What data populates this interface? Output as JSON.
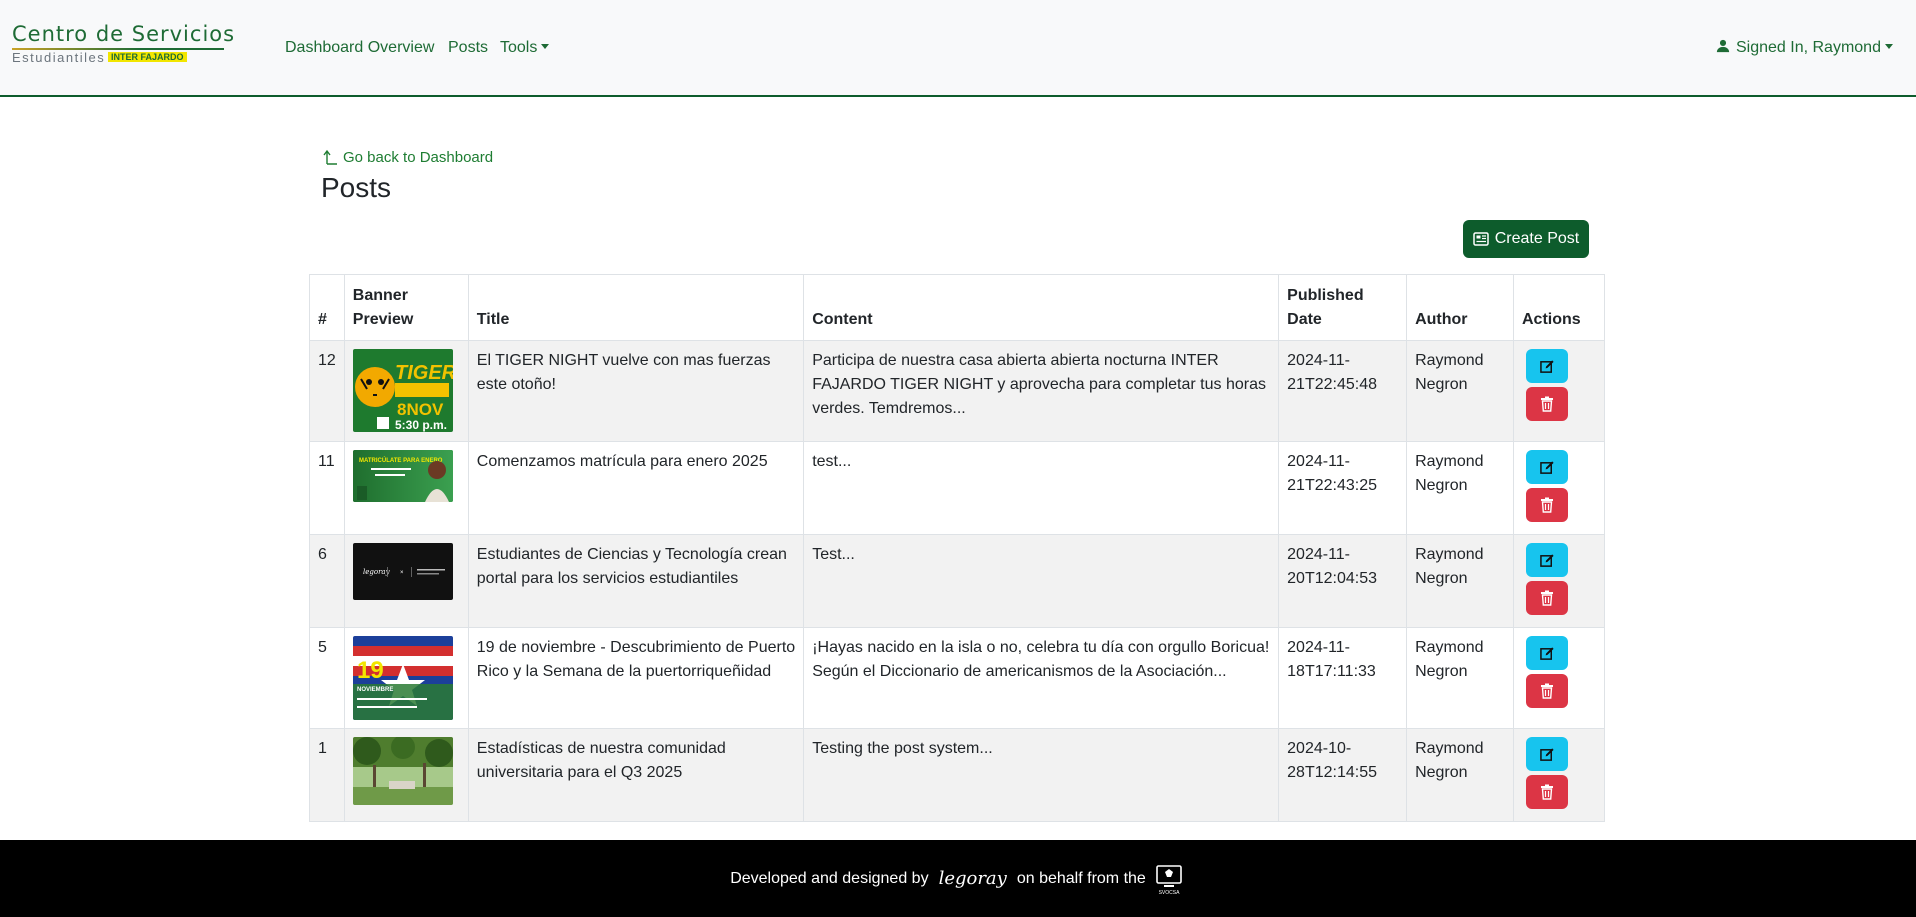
{
  "brand": {
    "line1": "Centro de Servicios",
    "line2": "Estudiantiles",
    "inter": "INTER",
    "inter_campus": "FAJARDO"
  },
  "nav": {
    "dashboard": "Dashboard Overview",
    "posts": "Posts",
    "tools": "Tools",
    "user": "Signed In, Raymond"
  },
  "main": {
    "back_link": "Go back to Dashboard",
    "title": "Posts",
    "create_button": "Create Post"
  },
  "table": {
    "headers": {
      "num": "#",
      "banner": "Banner Preview",
      "title": "Title",
      "content": "Content",
      "published": "Published Date",
      "author": "Author",
      "actions": "Actions"
    },
    "rows": [
      {
        "id": "12",
        "title": "El TIGER NIGHT vuelve con mas fuerzas este otoño!",
        "content": "Participa de nuestra casa abierta abierta nocturna INTER FAJARDO TIGER NIGHT y aprovecha para completar tus horas verdes. Temdremos...",
        "date_a": "2024-11-",
        "date_b": "21T22:45:48",
        "author_a": "Raymond",
        "author_b": "Negron",
        "thumb": {
          "bg": "#1e7a2e",
          "accent": "#f2c200",
          "text1": "TIGER",
          "text2": "8NOV",
          "text3": "5:30 p.m."
        }
      },
      {
        "id": "11",
        "title": "Comenzamos matrícula para enero 2025",
        "content": "test...",
        "date_a": "2024-11-",
        "date_b": "21T22:43:25",
        "author_a": "Raymond",
        "author_b": "Negron",
        "thumb": {
          "bg": "#2e8b3e",
          "accent": "#f2e600",
          "text1": "MATRICÚLATE PARA ENERO"
        }
      },
      {
        "id": "6",
        "title": "Estudiantes de Ciencias y Tecnología crean portal para los servicios estudiantiles",
        "content": "Test...",
        "date_a": "2024-11-",
        "date_b": "20T12:04:53",
        "author_a": "Raymond",
        "author_b": "Negron",
        "thumb": {
          "bg": "#111111",
          "accent": "#ffffff"
        }
      },
      {
        "id": "5",
        "title": "19 de noviembre - Descubrimiento de Puerto Rico y la Semana de la puertorriqueñidad",
        "content": "¡Hayas nacido en la isla o no, celebra tu día con orgullo Boricua! Según el Diccionario de americanismos de la Asociación...",
        "date_a": "2024-11-",
        "date_b": "18T17:11:33",
        "author_a": "Raymond",
        "author_b": "Negron",
        "thumb": {
          "bg": "#1c3f9a",
          "accent": "#d32f2f",
          "text1": "19",
          "text2": "NOVIEMBRE"
        }
      },
      {
        "id": "1",
        "title": "Estadísticas de nuestra comunidad universitaria para el Q3 2025",
        "content": "Testing the post system...",
        "date_a": "2024-10-",
        "date_b": "28T12:14:55",
        "author_a": "Raymond",
        "author_b": "Negron",
        "thumb": {
          "bg": "#5f8a3a",
          "accent": "#a7c98a"
        }
      }
    ]
  },
  "footer": {
    "prefix": "Developed and designed by",
    "signature": "legoray",
    "middle": "on behalf from the",
    "logo_text": "SVOCSA"
  },
  "colors": {
    "brand_green": "#0d5c2c",
    "link_green": "#1e6b35",
    "edit_cyan": "#17c4ee",
    "delete_red": "#dc3545"
  }
}
